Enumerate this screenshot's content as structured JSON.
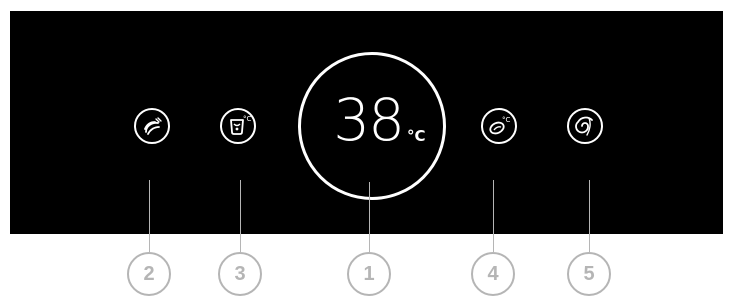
{
  "display": {
    "temperature": "38",
    "unit": "°C"
  },
  "buttons": [
    {
      "icon": "heat-waves-icon"
    },
    {
      "icon": "cup-temperature-icon"
    },
    {
      "icon": "dish-temperature-icon"
    },
    {
      "icon": "spiral-icon"
    }
  ],
  "callouts": [
    "1",
    "2",
    "3",
    "4",
    "5"
  ],
  "colors": {
    "panel": "#000000",
    "foreground": "#ffffff",
    "callout": "#b5b5b5"
  }
}
